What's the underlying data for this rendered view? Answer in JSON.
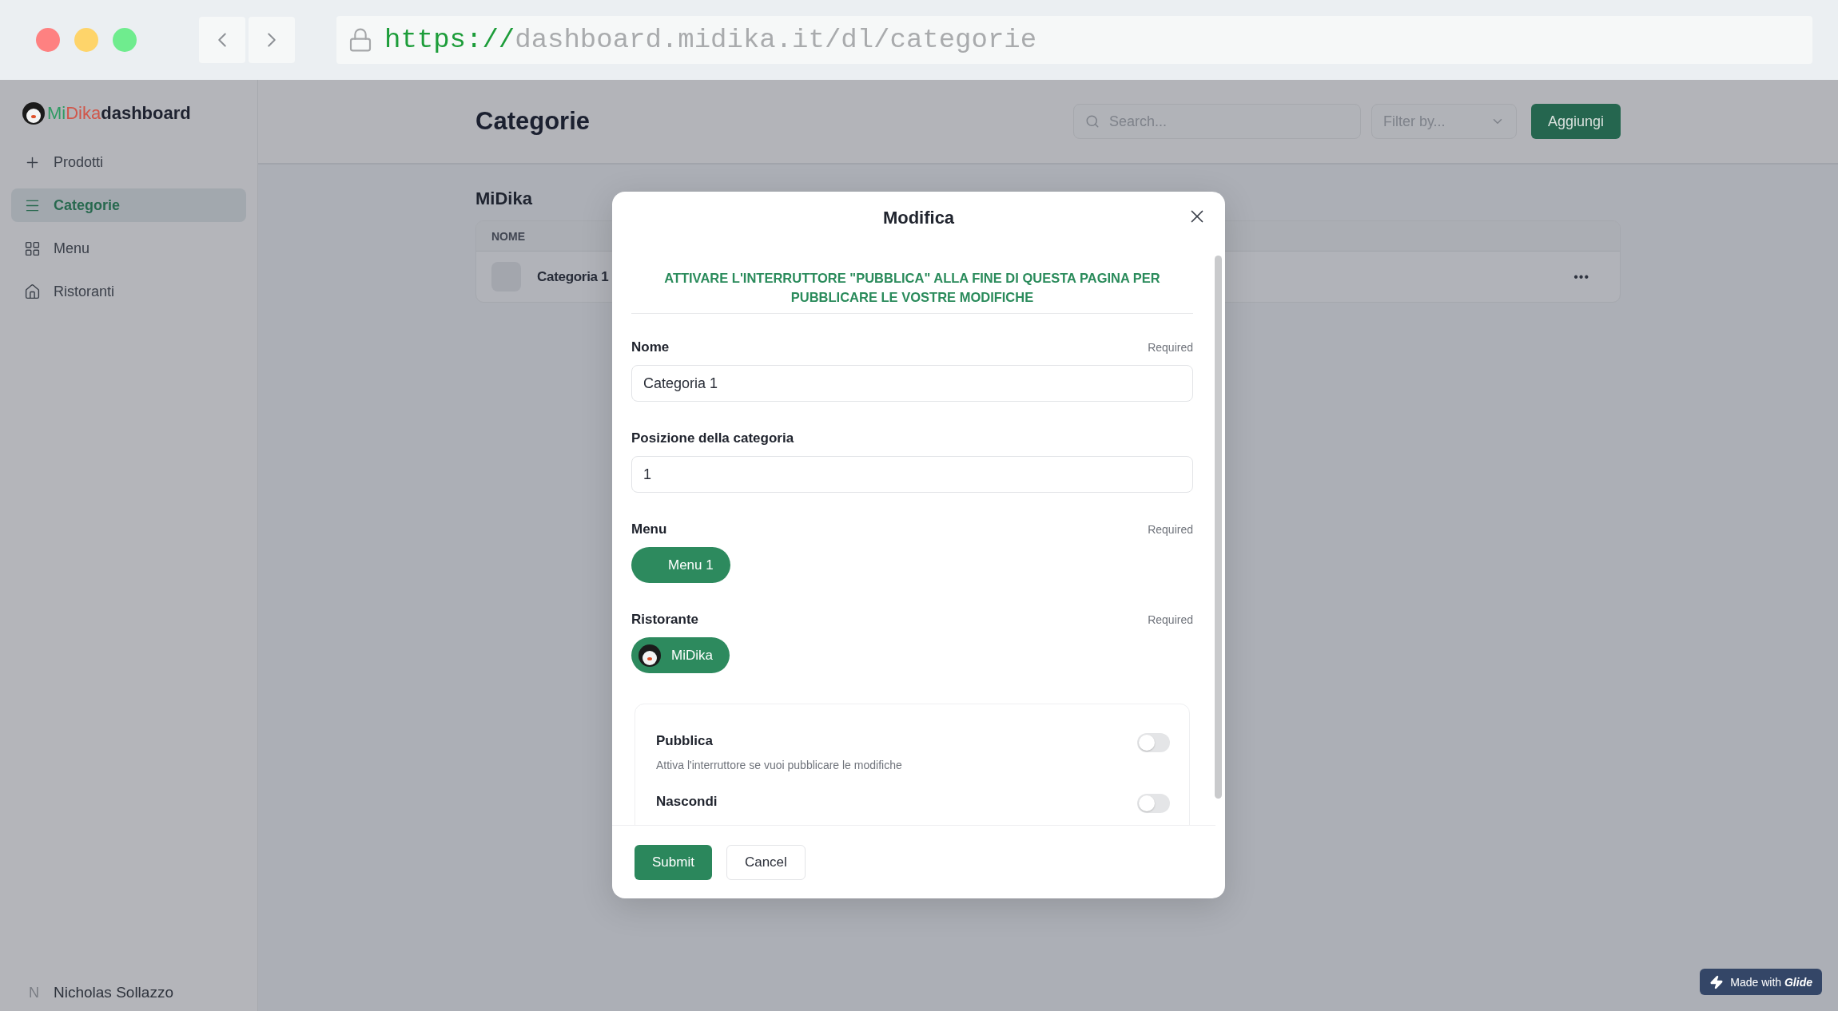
{
  "browser": {
    "url_scheme": "https://",
    "url_rest": "dashboard.midika.it/dl/categorie"
  },
  "sidebar": {
    "logo": [
      "Mi",
      "Dika",
      "dashboard"
    ],
    "items": [
      {
        "label": "Prodotti",
        "selected": false
      },
      {
        "label": "Categorie",
        "selected": true
      },
      {
        "label": "Menu",
        "selected": false
      },
      {
        "label": "Ristoranti",
        "selected": false
      }
    ],
    "user": {
      "initial": "N",
      "name": "Nicholas Sollazzo"
    }
  },
  "header": {
    "title": "Categorie",
    "search": {
      "placeholder": "Search..."
    },
    "filter": {
      "placeholder": "Filter by..."
    },
    "add_button": "Aggiungi"
  },
  "content": {
    "group_title": "MiDika",
    "table": {
      "columns": [
        "NOME"
      ],
      "rows": [
        {
          "name": "Categoria 1",
          "actions": "•••"
        }
      ]
    }
  },
  "modal": {
    "title": "Modifica",
    "notice": "ATTIVARE L'INTERRUTTORE \"PUBBLICA\" ALLA FINE DI QUESTA PAGINA PER PUBBLICARE LE VOSTRE MODIFICHE",
    "fields": [
      {
        "kind": "text",
        "label": "Nome",
        "required": "Required",
        "value": "Categoria 1"
      },
      {
        "kind": "text",
        "label": "Posizione della categoria",
        "value": "1"
      },
      {
        "kind": "chip",
        "label": "Menu",
        "required": "Required",
        "chip": "Menu 1",
        "avatar": false
      },
      {
        "kind": "chip",
        "label": "Ristorante",
        "required": "Required",
        "chip": "MiDika",
        "avatar": true
      }
    ],
    "toggles": [
      {
        "label": "Pubblica",
        "description": "Attiva l'interruttore se vuoi pubblicare le modifiche",
        "on": false
      },
      {
        "label": "Nascondi",
        "on": false
      }
    ],
    "buttons": [
      {
        "label": "Submit",
        "kind": "primary"
      },
      {
        "label": "Cancel",
        "kind": "secondary"
      }
    ]
  },
  "badge": "Made with **Glide**"
}
